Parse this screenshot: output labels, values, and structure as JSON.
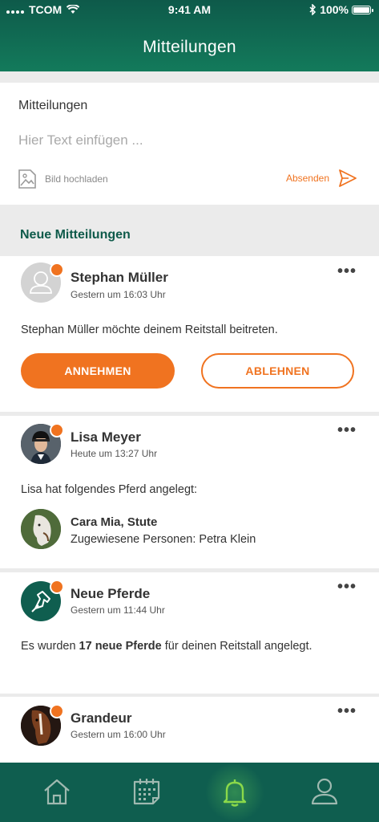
{
  "status_bar": {
    "carrier": "TCOM",
    "time": "9:41 AM",
    "battery": "100%",
    "battery_level": 1.0
  },
  "header": {
    "title": "Mitteilungen"
  },
  "composer": {
    "label": "Mitteilungen",
    "placeholder": "Hier Text einfügen ...",
    "upload_label": "Bild hochladen",
    "send_label": "Absenden"
  },
  "section": {
    "title": "Neue Mitteilungen"
  },
  "notifications": [
    {
      "name": "Stephan Müller",
      "time": "Gestern um 16:03 Uhr",
      "message": "Stephan Müller möchte deinem Reitstall beitreten.",
      "accept_label": "ANNEHMEN",
      "decline_label": "ABLEHNEN",
      "more": "•••"
    },
    {
      "name": "Lisa Meyer",
      "time": "Heute um 13:27 Uhr",
      "message": "Lisa hat folgendes Pferd angelegt:",
      "horse_name": "Cara Mia, Stute",
      "horse_persons": "Zugewiesene Personen: Petra Klein",
      "more": "•••"
    },
    {
      "name": "Neue Pferde",
      "time": "Gestern um 11:44 Uhr",
      "message_pre": "Es wurden ",
      "message_bold": "17 neue Pferde",
      "message_post": " für deinen Reitstall angelegt.",
      "more": "•••"
    },
    {
      "name": "Grandeur",
      "time": "Gestern um 16:00 Uhr",
      "more": "•••"
    }
  ],
  "tabbar": {
    "items": [
      "home-icon",
      "calendar-icon",
      "bell-icon",
      "profile-icon"
    ],
    "active": "bell-icon"
  },
  "colors": {
    "accent": "#f07320",
    "primary": "#0e5a4a",
    "tabbar": "#0f5e4f",
    "active_icon": "#8bd94a"
  }
}
